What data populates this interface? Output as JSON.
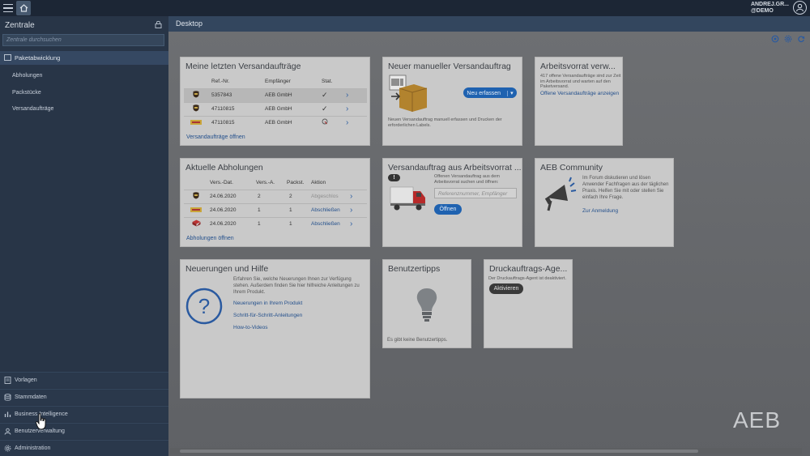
{
  "topbar": {
    "user_line1": "ANDREJ.GR...",
    "user_line2": "@DEMO"
  },
  "sidebar": {
    "title": "Zentrale",
    "search_placeholder": "Zentrale durchsuchen",
    "section": "Paketabwicklung",
    "items": [
      "Abholungen",
      "Packstücke",
      "Versandaufträge"
    ],
    "bottom": [
      "Vorlagen",
      "Stammdaten",
      "Business Intelligence",
      "Benutzerverwaltung",
      "Administration"
    ]
  },
  "main": {
    "title": "Desktop"
  },
  "card_versand": {
    "title": "Meine letzten Versandaufträge",
    "cols": [
      "Ref.-Nr.",
      "Empfänger",
      "Stat."
    ],
    "rows": [
      {
        "carrier": "UPS",
        "ref": "5357843",
        "recipient": "AEB GmbH"
      },
      {
        "carrier": "UPS",
        "ref": "47110815",
        "recipient": "AEB GmbH"
      },
      {
        "carrier": "DHL",
        "ref": "47110815",
        "recipient": "AEB GmbH"
      }
    ],
    "link": "Versandaufträge öffnen"
  },
  "card_manuell": {
    "title": "Neuer manueller Versandauftrag",
    "button": "Neu erfassen",
    "text": "Neuen Versandauftrag manuell erfassen und Drucken der erforderlichen Labels."
  },
  "card_arbeitsvorrat": {
    "title": "Arbeitsvorrat verw...",
    "text": "417 offene Versandaufträge sind zur Zeit im Arbeitsvorrat und warten auf den Paketversand.",
    "link": "Offene Versandaufträge anzeigen"
  },
  "card_abholungen": {
    "title": "Aktuelle Abholungen",
    "cols": [
      "Vers.-Dat.",
      "Vers.-A.",
      "Packst.",
      "Aktion"
    ],
    "rows": [
      {
        "carrier": "UPS",
        "date": "24.06.2020",
        "va": "2",
        "pk": "2",
        "action": "Abgeschlos"
      },
      {
        "carrier": "DHL",
        "date": "24.06.2020",
        "va": "1",
        "pk": "1",
        "action": "Abschließen"
      },
      {
        "carrier": "OTHER",
        "date": "24.06.2020",
        "va": "1",
        "pk": "1",
        "action": "Abschließen"
      }
    ],
    "link": "Abholungen öffnen"
  },
  "card_ausvorrat": {
    "title": "Versandauftrag aus Arbeitsvorrat ...",
    "text": "Offenen Versandauftrag aus dem Arbeitsvorrat suchen und öffnen:",
    "placeholder": "Referenznummer, Empfänger",
    "button": "Öffnen",
    "badge": "!"
  },
  "card_community": {
    "title": "AEB Community",
    "text": "Im Forum diskutieren und lösen Anwender Fachfragen aus der täglichen Praxis. Helfen Sie mit oder stellen Sie einfach Ihre Frage.",
    "link": "Zur Anmeldung"
  },
  "card_neuerungen": {
    "title": "Neuerungen und Hilfe",
    "text": "Erfahren Sie, welche Neuerungen Ihnen zur Verfügung stehen. Außerdem finden Sie hier hilfreiche Anleitungen zu Ihrem Produkt.",
    "links": [
      "Neuerungen in Ihrem Produkt",
      "Schritt-für-Schritt-Anleitungen",
      "How-to-Videos"
    ]
  },
  "card_tipps": {
    "title": "Benutzertipps",
    "text": "Es gibt keine Benutzertipps."
  },
  "card_druck": {
    "title": "Druckauftrags-Age...",
    "text": "Der Druckauftrags-Agent ist deaktiviert.",
    "button": "Aktivieren"
  },
  "brand": "AEB"
}
